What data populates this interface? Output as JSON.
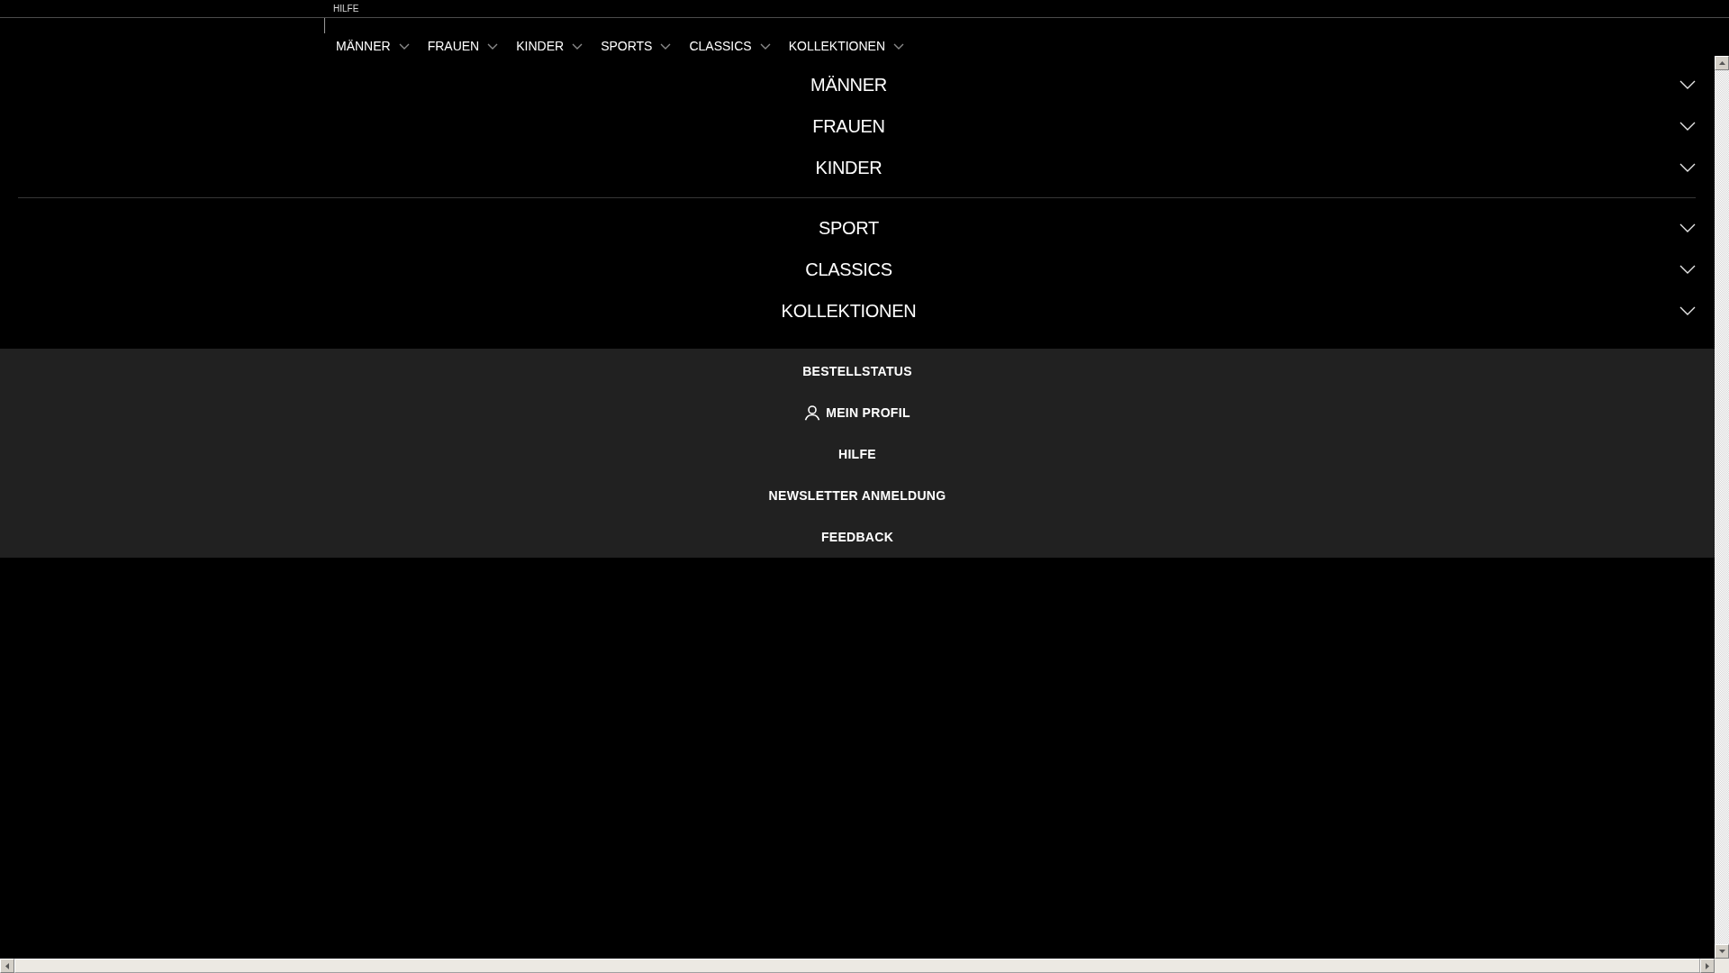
{
  "top_bar": {
    "help_link": "HILFE"
  },
  "top_nav": [
    {
      "label": "MÄNNER"
    },
    {
      "label": "FRAUEN"
    },
    {
      "label": "KINDER"
    },
    {
      "label": "SPORTS"
    },
    {
      "label": "CLASSICS"
    },
    {
      "label": "KOLLEKTIONEN"
    }
  ],
  "menu": {
    "groups": [
      {
        "items": [
          {
            "label": "MÄNNER",
            "expanded": false
          },
          {
            "label": "FRAUEN",
            "expanded": false
          },
          {
            "label": "KINDER",
            "expanded": false
          }
        ]
      },
      {
        "items": [
          {
            "label": "SPORT",
            "expanded": false
          },
          {
            "label": "CLASSICS",
            "expanded": false
          },
          {
            "label": "KOLLEKTIONEN",
            "expanded": false
          }
        ]
      }
    ]
  },
  "service_links": [
    {
      "label": "BESTELLSTATUS",
      "kind": "link"
    },
    {
      "label": "MEIN PROFIL",
      "kind": "profile"
    },
    {
      "label": "HILFE",
      "kind": "link"
    },
    {
      "label": "NEWSLETTER ANMELDUNG",
      "kind": "link"
    },
    {
      "label": "FEEDBACK",
      "kind": "link"
    }
  ]
}
